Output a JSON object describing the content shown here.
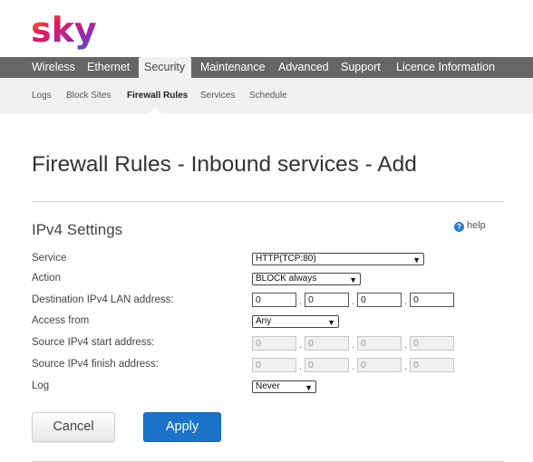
{
  "brand": {
    "logo_name": "sky"
  },
  "main_nav": {
    "tabs": [
      "Wireless",
      "Ethernet",
      "Security",
      "Maintenance",
      "Advanced",
      "Support",
      "Licence Information"
    ],
    "active": "Security"
  },
  "sub_nav": {
    "items": [
      "Logs",
      "Block Sites",
      "Firewall Rules",
      "Services",
      "Schedule"
    ],
    "active": "Firewall Rules"
  },
  "page": {
    "title": "Firewall Rules - Inbound services - Add",
    "section_title": "IPv4 Settings",
    "help_label": "help"
  },
  "form": {
    "service": {
      "label": "Service",
      "value": "HTTP(TCP:80)"
    },
    "action": {
      "label": "Action",
      "value": "BLOCK always"
    },
    "dest_ip": {
      "label": "Destination IPv4 LAN address:",
      "octets": [
        "0",
        "0",
        "0",
        "0"
      ]
    },
    "access_from": {
      "label": "Access from",
      "value": "Any"
    },
    "src_start": {
      "label": "Source IPv4 start address:",
      "octets": [
        "0",
        "0",
        "0",
        "0"
      ]
    },
    "src_finish": {
      "label": "Source IPv4 finish address:",
      "octets": [
        "0",
        "0",
        "0",
        "0"
      ]
    },
    "log": {
      "label": "Log",
      "value": "Never"
    },
    "octet_separator": "."
  },
  "buttons": {
    "cancel": "Cancel",
    "apply": "Apply"
  },
  "colors": {
    "nav_bg": "#666666",
    "subnav_bg": "#f1f1f1",
    "apply_bg": "#1a73c9"
  }
}
